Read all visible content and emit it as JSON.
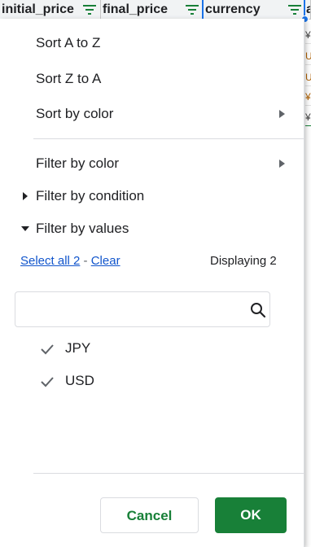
{
  "headers": {
    "col1": "initial_price",
    "col2": "final_price",
    "col3": "currency",
    "col4_partial": "a"
  },
  "peek_cells": [
    "¥",
    "U",
    "U",
    "¥",
    "¥"
  ],
  "menu": {
    "sort_az": "Sort A to Z",
    "sort_za": "Sort Z to A",
    "sort_color": "Sort by color",
    "filter_color": "Filter by color",
    "filter_condition": "Filter by condition",
    "filter_values": "Filter by values"
  },
  "values_panel": {
    "select_all": "Select all 2",
    "dash": "-",
    "clear": "Clear",
    "displaying": "Displaying 2",
    "search_placeholder": "",
    "items": [
      {
        "label": "JPY",
        "checked": true
      },
      {
        "label": "USD",
        "checked": true
      }
    ]
  },
  "buttons": {
    "cancel": "Cancel",
    "ok": "OK"
  },
  "colors": {
    "accent_green": "#188038",
    "link_blue": "#1155cc",
    "selection_blue": "#1a73e8"
  }
}
